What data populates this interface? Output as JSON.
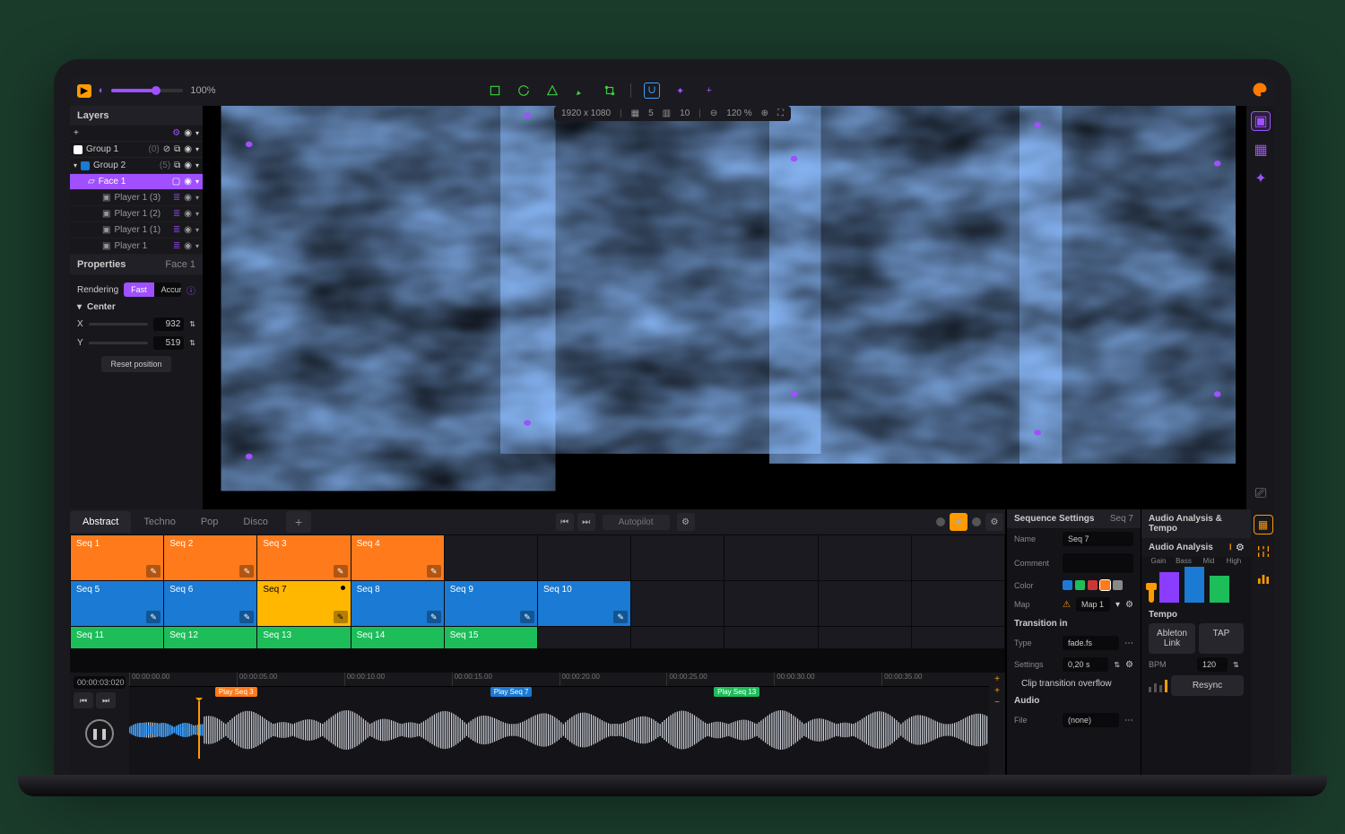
{
  "topbar": {
    "zoom": "100%",
    "resolution": "1920 x 1080",
    "grid_a": "5",
    "grid_b": "10",
    "view_pct": "120 %"
  },
  "layers": {
    "title": "Layers",
    "items": [
      {
        "name": "Group 1",
        "count": "(0)",
        "swatch": "#ffffff"
      },
      {
        "name": "Group 2",
        "count": "(5)",
        "swatch": "#1a7ad4"
      },
      {
        "name": "Face 1",
        "selected": true
      },
      {
        "name": "Player 1 (3)"
      },
      {
        "name": "Player 1 (2)"
      },
      {
        "name": "Player 1 (1)"
      },
      {
        "name": "Player 1"
      }
    ]
  },
  "properties": {
    "title": "Properties",
    "target": "Face 1",
    "rendering_label": "Rendering",
    "rendering_fast": "Fast",
    "rendering_accurate": "Accurate",
    "center_label": "Center",
    "x_label": "X",
    "x_val": "932",
    "y_label": "Y",
    "y_val": "519",
    "reset": "Reset position"
  },
  "tabs": [
    "Abstract",
    "Techno",
    "Pop",
    "Disco"
  ],
  "autopilot": "Autopilot",
  "sequences": [
    [
      "Seq 1",
      "Seq 2",
      "Seq 3",
      "Seq 4",
      "",
      "",
      "",
      "",
      "",
      ""
    ],
    [
      "Seq 5",
      "Seq 6",
      "Seq 7",
      "Seq 8",
      "Seq 9",
      "Seq 10",
      "",
      "",
      "",
      ""
    ],
    [
      "Seq 11",
      "Seq 12",
      "Seq 13",
      "Seq 14",
      "Seq 15",
      "",
      "",
      "",
      "",
      ""
    ]
  ],
  "seq_colors": [
    [
      "orange",
      "orange",
      "orange",
      "orange",
      "empty",
      "empty",
      "empty",
      "empty",
      "empty",
      "empty"
    ],
    [
      "blue",
      "blue",
      "yellow",
      "blue",
      "blue",
      "blue",
      "empty",
      "empty",
      "empty",
      "empty"
    ],
    [
      "green",
      "green",
      "green",
      "green",
      "green",
      "empty",
      "empty",
      "empty",
      "empty",
      "empty"
    ]
  ],
  "timeline": {
    "timecode": "00:00:03:020",
    "ticks": [
      "00:00:00.00",
      "00:00:05.00",
      "00:00:10.00",
      "00:00:15.00",
      "00:00:20.00",
      "00:00:25.00",
      "00:00:30.00",
      "00:00:35.00"
    ],
    "markers": [
      {
        "label": "Play Seq 3",
        "color": "orange",
        "pos": 10
      },
      {
        "label": "Play Seq 7",
        "color": "blue",
        "pos": 42
      },
      {
        "label": "Play Seq 13",
        "color": "green",
        "pos": 68
      }
    ]
  },
  "seq_settings": {
    "title": "Sequence Settings",
    "target": "Seq 7",
    "name_label": "Name",
    "name_val": "Seq 7",
    "comment_label": "Comment",
    "color_label": "Color",
    "colors": [
      "#1a7ad4",
      "#1dbd5a",
      "#c93838",
      "#ff7a1a",
      "#888888"
    ],
    "map_label": "Map",
    "map_val": "Map 1",
    "trans_title": "Transition in",
    "type_label": "Type",
    "type_val": "fade.fs",
    "settings_label": "Settings",
    "settings_val": "0,20 s",
    "overflow": "Clip transition overflow",
    "audio_title": "Audio",
    "file_label": "File",
    "file_val": "(none)"
  },
  "audio_panel": {
    "title": "Audio Analysis & Tempo",
    "analysis_title": "Audio Analysis",
    "bands": [
      "Gain",
      "Bass",
      "Mid",
      "High"
    ],
    "band_heights": [
      18,
      34,
      40,
      30
    ],
    "band_colors": [
      "#ff9a00",
      "#8a3dff",
      "#1a7ad4",
      "#1dbd5a"
    ],
    "tempo_title": "Tempo",
    "ableton": "Ableton Link",
    "tap": "TAP",
    "bpm_label": "BPM",
    "bpm_val": "120",
    "resync": "Resync"
  }
}
